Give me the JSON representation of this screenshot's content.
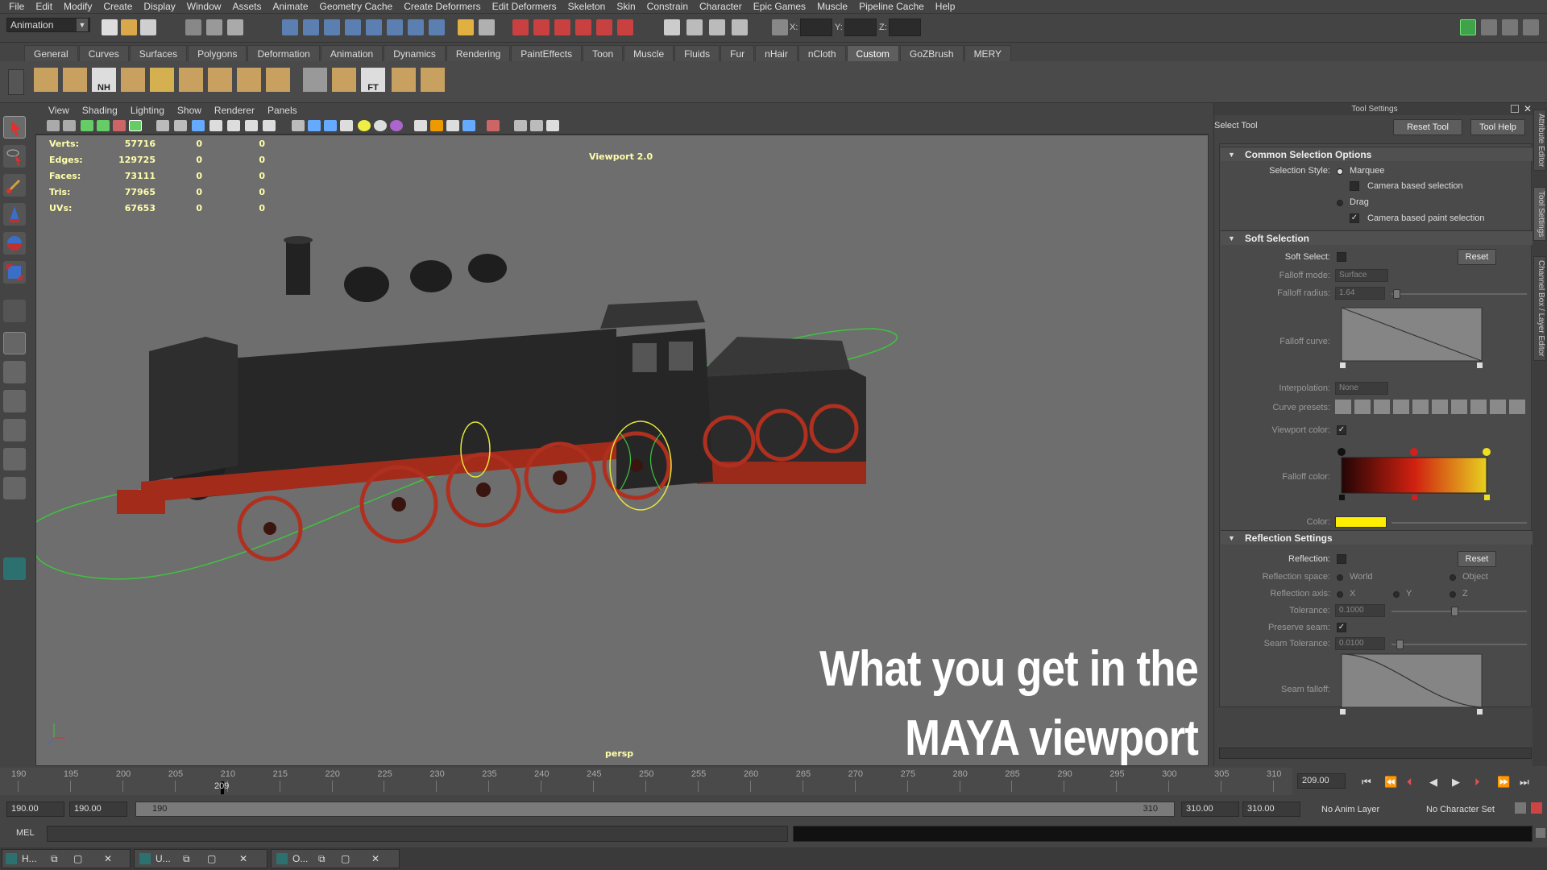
{
  "menubar": [
    "File",
    "Edit",
    "Modify",
    "Create",
    "Display",
    "Window",
    "Assets",
    "Animate",
    "Geometry Cache",
    "Create Deformers",
    "Edit Deformers",
    "Skeleton",
    "Skin",
    "Constrain",
    "Character",
    "Epic Games",
    "Muscle",
    "Pipeline Cache",
    "Help"
  ],
  "status": {
    "mode_menu": "Animation",
    "x_label": "X:",
    "y_label": "Y:",
    "z_label": "Z:"
  },
  "shelf_tabs": [
    "General",
    "Curves",
    "Surfaces",
    "Polygons",
    "Deformation",
    "Animation",
    "Dynamics",
    "Rendering",
    "PaintEffects",
    "Toon",
    "Muscle",
    "Fluids",
    "Fur",
    "nHair",
    "nCloth",
    "Custom",
    "GoZBrush",
    "MERY"
  ],
  "shelf_active": "Custom",
  "shelf_icon_labels": {
    "nh": "NH",
    "ft": "FT"
  },
  "panel_menu": [
    "View",
    "Shading",
    "Lighting",
    "Show",
    "Renderer",
    "Panels"
  ],
  "hud": {
    "rows": [
      {
        "label": "Verts:",
        "v1": "57716",
        "v2": "0",
        "v3": "0"
      },
      {
        "label": "Edges:",
        "v1": "129725",
        "v2": "0",
        "v3": "0"
      },
      {
        "label": "Faces:",
        "v1": "73111",
        "v2": "0",
        "v3": "0"
      },
      {
        "label": "Tris:",
        "v1": "77965",
        "v2": "0",
        "v3": "0"
      },
      {
        "label": "UVs:",
        "v1": "67653",
        "v2": "0",
        "v3": "0"
      }
    ],
    "renderer": "Viewport 2.0",
    "camera": "persp"
  },
  "overlay": {
    "line1": "What you get in the",
    "line2": "MAYA viewport"
  },
  "tool_settings": {
    "panel_title": "Tool Settings",
    "tool_name": "Select Tool",
    "reset_tool": "Reset Tool",
    "tool_help": "Tool Help",
    "common": {
      "title": "Common Selection Options",
      "selection_style_label": "Selection Style:",
      "marquee": "Marquee",
      "camera_based_selection": "Camera based selection",
      "drag": "Drag",
      "camera_based_paint": "Camera based paint selection"
    },
    "soft": {
      "title": "Soft Selection",
      "soft_select_label": "Soft Select:",
      "reset": "Reset",
      "falloff_mode_label": "Falloff mode:",
      "falloff_mode_value": "Surface",
      "falloff_radius_label": "Falloff radius:",
      "falloff_radius_value": "1.64",
      "falloff_curve_label": "Falloff curve:",
      "interpolation_label": "Interpolation:",
      "interpolation_value": "None",
      "curve_presets_label": "Curve presets:",
      "viewport_color_label": "Viewport color:",
      "falloff_color_label": "Falloff color:",
      "color_label": "Color:"
    },
    "reflection": {
      "title": "Reflection Settings",
      "reflection_label": "Reflection:",
      "reset": "Reset",
      "space_label": "Reflection space:",
      "world": "World",
      "object": "Object",
      "axis_label": "Reflection axis:",
      "x": "X",
      "y": "Y",
      "z": "Z",
      "tolerance_label": "Tolerance:",
      "tolerance_value": "0.1000",
      "preserve_seam_label": "Preserve seam:",
      "seam_tolerance_label": "Seam Tolerance:",
      "seam_tolerance_value": "0.0100",
      "seam_falloff_label": "Seam falloff:"
    }
  },
  "side_tabs": [
    "Attribute Editor",
    "Tool Settings",
    "Channel Box / Layer Editor"
  ],
  "timeline": {
    "ticks": [
      "190",
      "195",
      "200",
      "205",
      "210",
      "215",
      "220",
      "225",
      "230",
      "235",
      "240",
      "245",
      "250",
      "255",
      "260",
      "265",
      "270",
      "275",
      "280",
      "285",
      "290",
      "295",
      "300",
      "305",
      "310"
    ],
    "current_frame_label": "209",
    "current_frame_field": "209.00"
  },
  "range": {
    "start": "190.00",
    "anim_start": "190.00",
    "range_start_label": "190",
    "range_end_label": "310",
    "anim_end": "310.00",
    "end": "310.00",
    "anim_layer": "No Anim Layer",
    "char_set": "No Character Set"
  },
  "cmdline": {
    "lang": "MEL"
  },
  "taskbar": [
    {
      "label": "H..."
    },
    {
      "label": "U..."
    },
    {
      "label": "O..."
    }
  ],
  "colors": {
    "hud_yellow": "#ffffaa",
    "viewport_bg": "#6e6e6e",
    "ui_bg": "#444444",
    "selection_green": "#3ec43e",
    "soft_color_swatch": "#ffee00"
  }
}
